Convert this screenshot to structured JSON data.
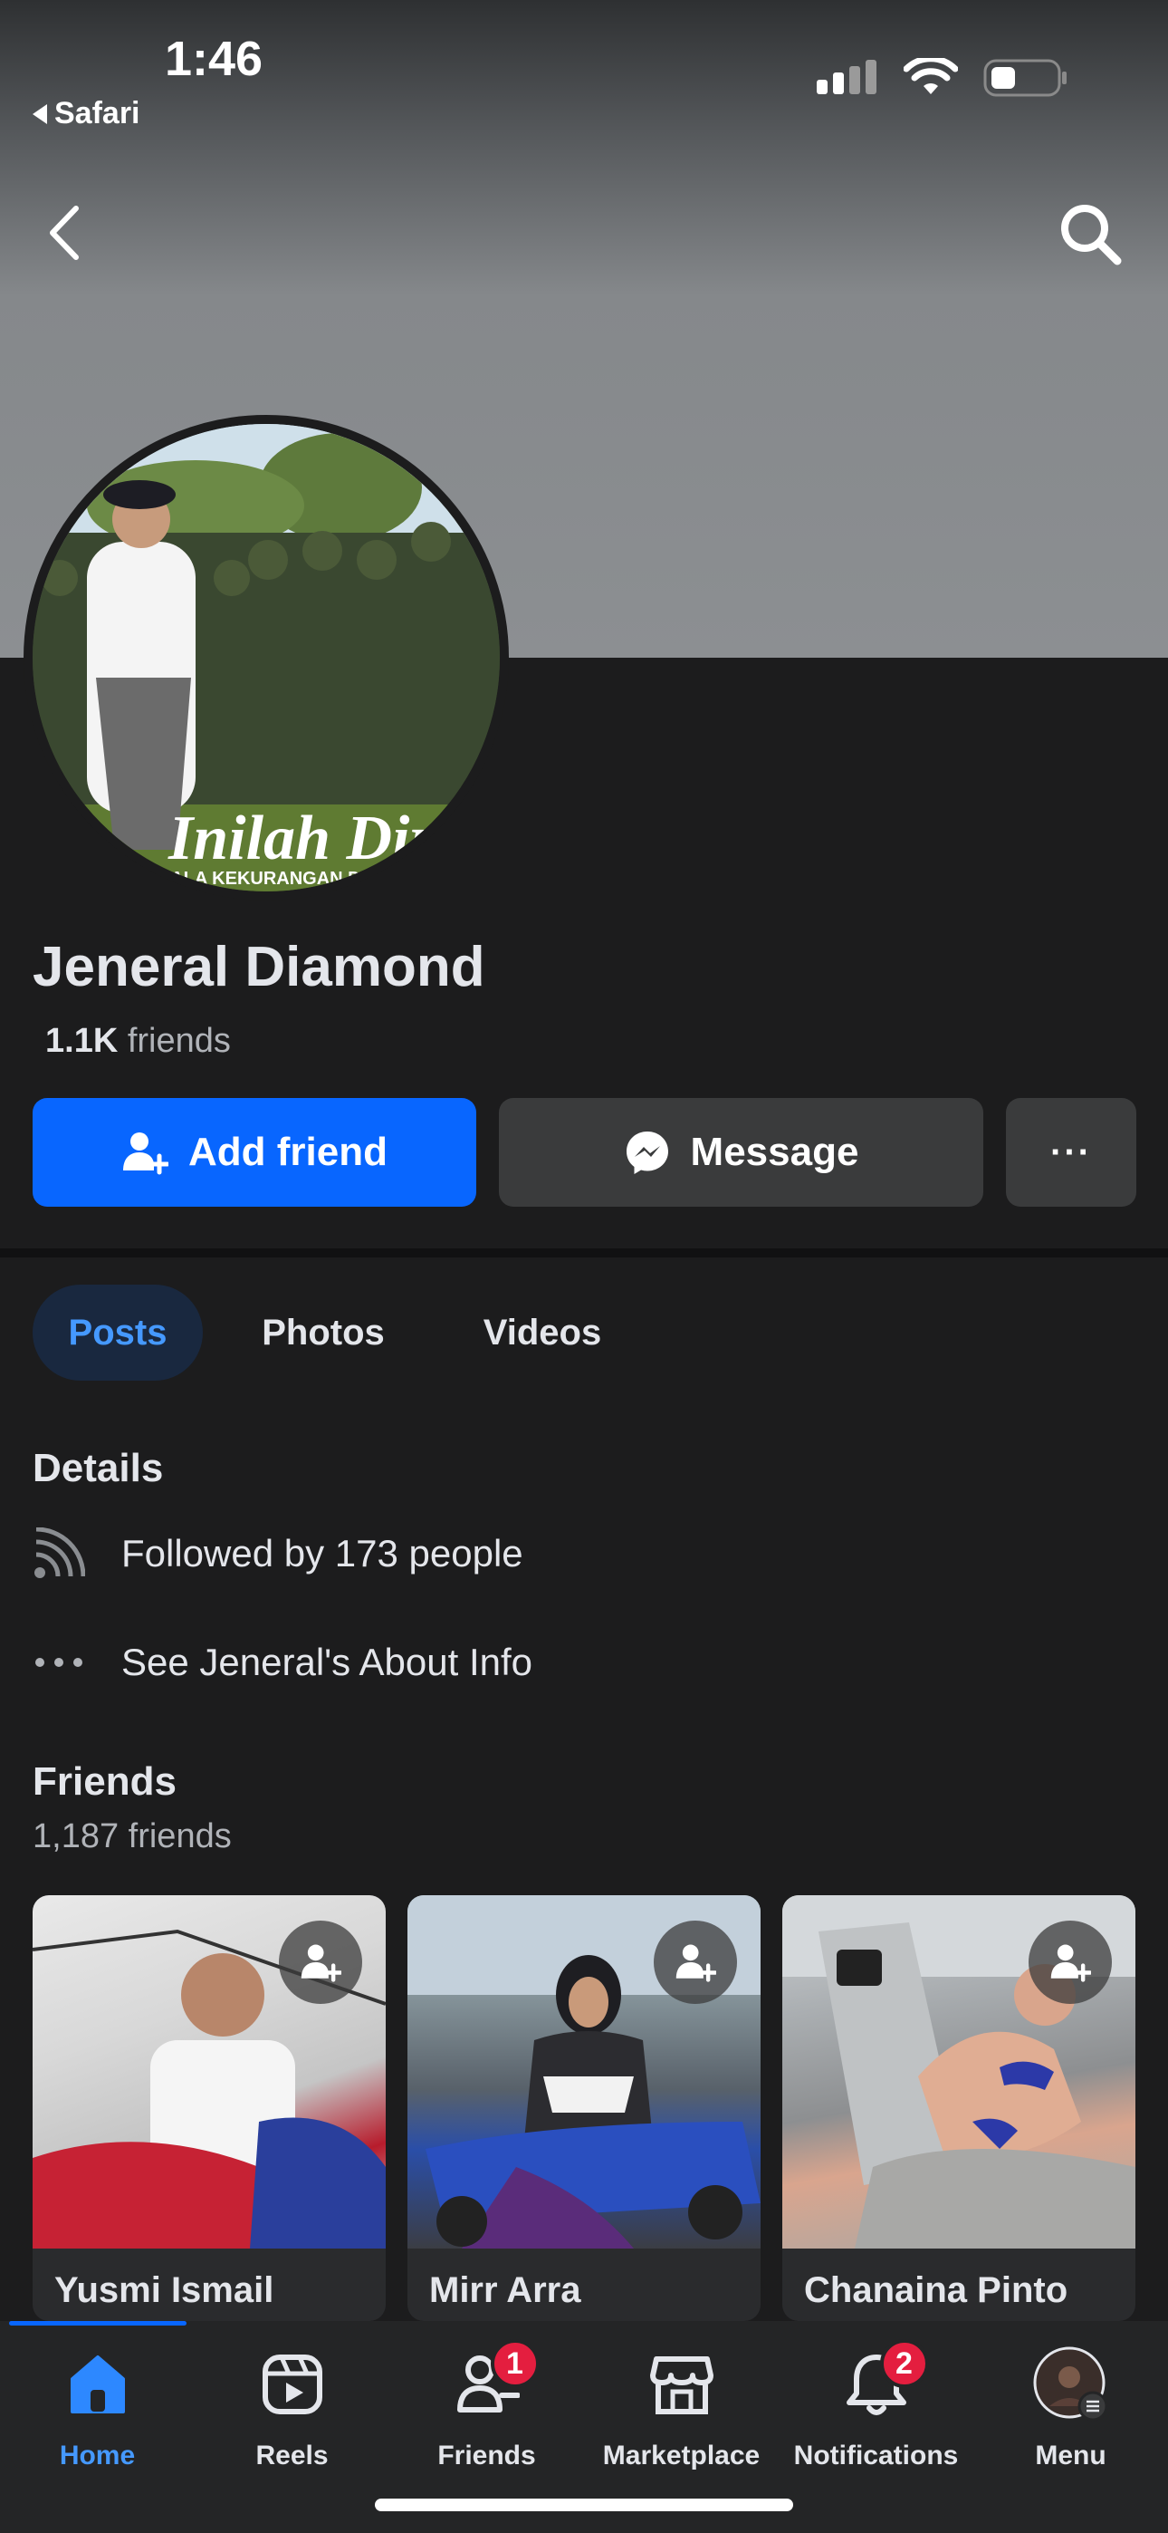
{
  "status_bar": {
    "time": "1:46",
    "back_app": "Safari"
  },
  "profile": {
    "name": "Jeneral Diamond",
    "friends_count": "1.1K",
    "friends_suffix": "friends",
    "avatar_caption": "Inilah Diri",
    "avatar_caption_sub": "SEGALA KEKURANGAN DAN..."
  },
  "actions": {
    "add_friend": "Add friend",
    "message": "Message",
    "more": "···"
  },
  "tabs": [
    {
      "label": "Posts",
      "selected": true
    },
    {
      "label": "Photos",
      "selected": false
    },
    {
      "label": "Videos",
      "selected": false
    }
  ],
  "details": {
    "title": "Details",
    "followed_by": "Followed by 173 people",
    "about": "See Jeneral's About Info"
  },
  "friends": {
    "title": "Friends",
    "count_label": "1,187 friends",
    "items": [
      {
        "name": "Yusmi Ismail"
      },
      {
        "name": "Mirr Arra"
      },
      {
        "name": "Chanaina Pinto"
      }
    ]
  },
  "tab_bar": {
    "items": [
      {
        "label": "Home",
        "icon": "home-icon",
        "active": true
      },
      {
        "label": "Reels",
        "icon": "reels-icon"
      },
      {
        "label": "Friends",
        "icon": "friends-icon",
        "badge": "1"
      },
      {
        "label": "Marketplace",
        "icon": "marketplace-icon"
      },
      {
        "label": "Notifications",
        "icon": "bell-icon",
        "badge": "2"
      },
      {
        "label": "Menu",
        "icon": "menu-avatar"
      }
    ]
  },
  "colors": {
    "accent": "#0866ff",
    "background": "#1c1c1d",
    "badge": "#e41e3f"
  }
}
